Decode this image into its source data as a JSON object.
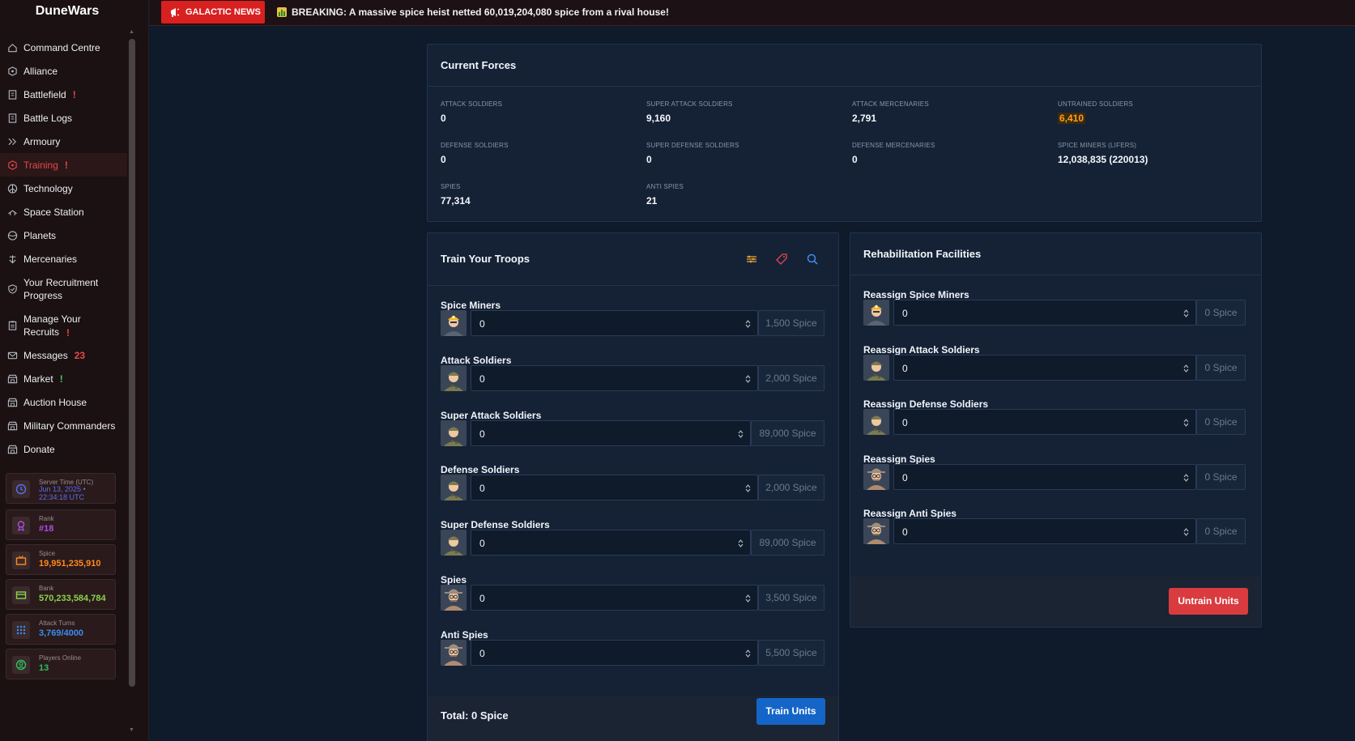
{
  "app": {
    "title": "DuneWars"
  },
  "sidebar": {
    "items": [
      {
        "label": "Command Centre",
        "alert": ""
      },
      {
        "label": "Alliance",
        "alert": ""
      },
      {
        "label": "Battlefield",
        "alert": "!"
      },
      {
        "label": "Battle Logs",
        "alert": ""
      },
      {
        "label": "Armoury",
        "alert": ""
      },
      {
        "label": "Training",
        "alert": "!"
      },
      {
        "label": "Technology",
        "alert": ""
      },
      {
        "label": "Space Station",
        "alert": ""
      },
      {
        "label": "Planets",
        "alert": ""
      },
      {
        "label": "Mercenaries",
        "alert": ""
      },
      {
        "label": "Your Recruitment Progress",
        "alert": ""
      },
      {
        "label": "Manage Your Recruits",
        "alert": "!"
      },
      {
        "label": "Messages",
        "alert": "23"
      },
      {
        "label": "Market",
        "alert": "!"
      },
      {
        "label": "Auction House",
        "alert": ""
      },
      {
        "label": "Military Commanders",
        "alert": ""
      },
      {
        "label": "Donate",
        "alert": ""
      }
    ],
    "active": "Training",
    "stats": {
      "server_time": {
        "label": "Server Time (UTC)",
        "value": "Jun 13, 2025 • 22:34:18 UTC",
        "color": "#5b6cf0"
      },
      "rank": {
        "label": "Rank",
        "value": "#18",
        "color": "#b04de0"
      },
      "spice": {
        "label": "Spice",
        "value": "19,951,235,910",
        "color": "#ff8a1e"
      },
      "bank": {
        "label": "Bank",
        "value": "570,233,584,784",
        "color": "#8ad24a"
      },
      "attack_turns": {
        "label": "Attack Turns",
        "value": "3,769/4000",
        "color": "#3b8cf0"
      },
      "players_online": {
        "label": "Players Online",
        "value": "13",
        "color": "#2fbf5a"
      }
    }
  },
  "news": {
    "badge": "GALACTIC NEWS",
    "text": "BREAKING: A massive spice heist netted 60,019,204,080 spice from a rival house!"
  },
  "current_forces": {
    "title": "Current Forces",
    "items": [
      {
        "label": "ATTACK SOLDIERS",
        "value": "0"
      },
      {
        "label": "SUPER ATTACK SOLDIERS",
        "value": "9,160"
      },
      {
        "label": "ATTACK MERCENARIES",
        "value": "2,791"
      },
      {
        "label": "UNTRAINED SOLDIERS",
        "value": "6,410"
      },
      {
        "label": "DEFENSE SOLDIERS",
        "value": "0"
      },
      {
        "label": "SUPER DEFENSE SOLDIERS",
        "value": "0"
      },
      {
        "label": "DEFENSE MERCENARIES",
        "value": "0"
      },
      {
        "label": "SPICE MINERS (LIFERS)",
        "value": "12,038,835 (220013)"
      },
      {
        "label": "SPIES",
        "value": "77,314"
      },
      {
        "label": "ANTI SPIES",
        "value": "21"
      }
    ]
  },
  "train": {
    "title": "Train Your Troops",
    "units": [
      {
        "label": "Spice Miners",
        "value": "0",
        "cost": "1,500 Spice",
        "avatar": "miner"
      },
      {
        "label": "Attack Soldiers",
        "value": "0",
        "cost": "2,000 Spice",
        "avatar": "soldier"
      },
      {
        "label": "Super Attack Soldiers",
        "value": "0",
        "cost": "89,000 Spice",
        "avatar": "soldier"
      },
      {
        "label": "Defense Soldiers",
        "value": "0",
        "cost": "2,000 Spice",
        "avatar": "soldier"
      },
      {
        "label": "Super Defense Soldiers",
        "value": "0",
        "cost": "89,000 Spice",
        "avatar": "soldier"
      },
      {
        "label": "Spies",
        "value": "0",
        "cost": "3,500 Spice",
        "avatar": "spy"
      },
      {
        "label": "Anti Spies",
        "value": "0",
        "cost": "5,500 Spice",
        "avatar": "spy"
      }
    ],
    "total": "Total: 0 Spice",
    "button": "Train Units"
  },
  "rehab": {
    "title": "Rehabilitation Facilities",
    "units": [
      {
        "label": "Reassign Spice Miners",
        "value": "0",
        "cost": "0 Spice",
        "avatar": "miner"
      },
      {
        "label": "Reassign Attack Soldiers",
        "value": "0",
        "cost": "0 Spice",
        "avatar": "soldier"
      },
      {
        "label": "Reassign Defense Soldiers",
        "value": "0",
        "cost": "0 Spice",
        "avatar": "soldier"
      },
      {
        "label": "Reassign Spies",
        "value": "0",
        "cost": "0 Spice",
        "avatar": "spy"
      },
      {
        "label": "Reassign Anti Spies",
        "value": "0",
        "cost": "0 Spice",
        "avatar": "spy"
      }
    ],
    "button": "Untrain Units"
  },
  "colors": {
    "accent_red": "#e5484d",
    "untrained_orange": "#ff9e1b",
    "train_blue": "#1565c8",
    "untrain_red": "#d93b3f"
  }
}
